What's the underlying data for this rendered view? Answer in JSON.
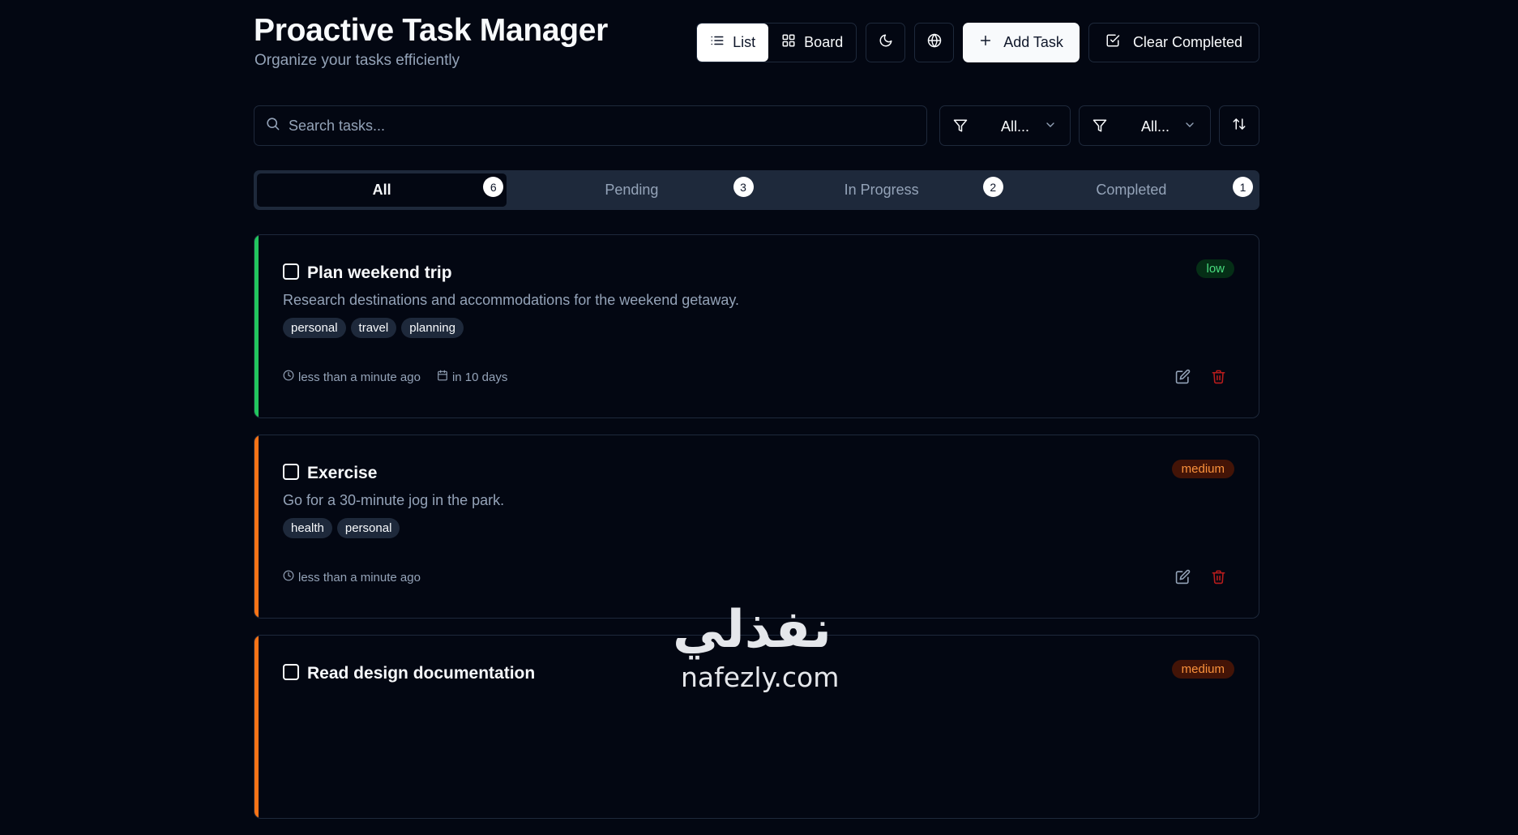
{
  "header": {
    "title": "Proactive Task Manager",
    "subtitle": "Organize your tasks efficiently"
  },
  "toolbar": {
    "view_list_label": "List",
    "view_board_label": "Board",
    "add_task_label": "Add Task",
    "clear_completed_label": "Clear Completed"
  },
  "search": {
    "placeholder": "Search tasks..."
  },
  "filters": [
    {
      "value": "All..."
    },
    {
      "value": "All..."
    }
  ],
  "tabs": [
    {
      "label": "All",
      "count": "6",
      "active": true
    },
    {
      "label": "Pending",
      "count": "3"
    },
    {
      "label": "In Progress",
      "count": "2"
    },
    {
      "label": "Completed",
      "count": "1"
    }
  ],
  "tasks": [
    {
      "title": "Plan weekend trip",
      "description": "Research destinations and accommodations for the weekend getaway.",
      "tags": [
        "personal",
        "travel",
        "planning"
      ],
      "priority": "low",
      "accent_color": "#22c55e",
      "created": "less than a minute ago",
      "due": "in 10 days"
    },
    {
      "title": "Exercise",
      "description": "Go for a 30-minute jog in the park.",
      "tags": [
        "health",
        "personal"
      ],
      "priority": "medium",
      "accent_color": "#f97316",
      "created": "less than a minute ago"
    },
    {
      "title": "Read design documentation",
      "priority": "medium",
      "accent_color": "#f97316"
    }
  ],
  "colors": {
    "background": "#030712",
    "border": "#1e293b",
    "muted_text": "#94a3b8",
    "low_priority": "#4ade80",
    "medium_priority": "#fb923c",
    "delete_red": "#b91c1c"
  },
  "watermark": {
    "arabic": "نفذلي",
    "latin": "nafezly.com"
  }
}
